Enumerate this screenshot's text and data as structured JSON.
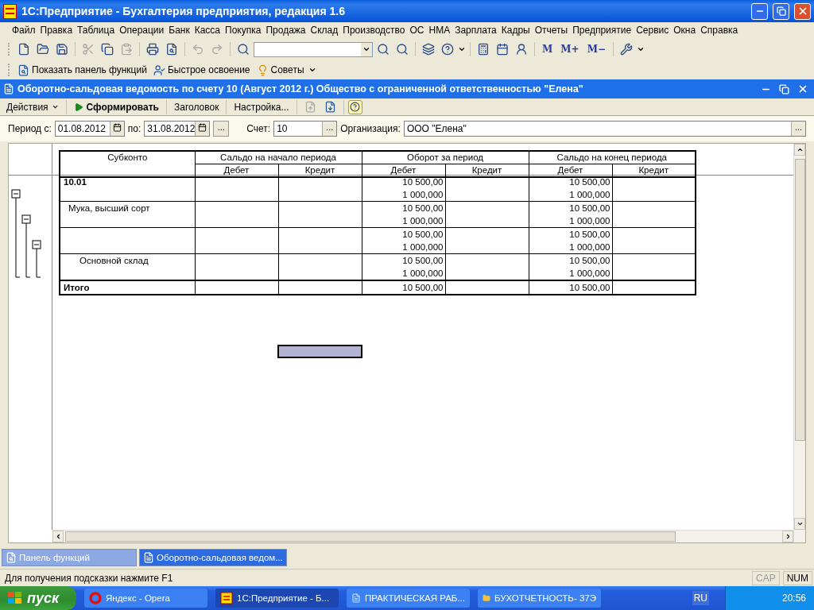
{
  "window": {
    "title": "1С:Предприятие - Бухгалтерия предприятия, редакция 1.6"
  },
  "menu": [
    "Файл",
    "Правка",
    "Таблица",
    "Операции",
    "Банк",
    "Касса",
    "Покупка",
    "Продажа",
    "Склад",
    "Производство",
    "ОС",
    "НМА",
    "Зарплата",
    "Кадры",
    "Отчеты",
    "Предприятие",
    "Сервис",
    "Окна",
    "Справка"
  ],
  "toolbar": [
    {
      "kind": "button",
      "disabled": false
    },
    {
      "kind": "button",
      "disabled": false
    },
    {
      "kind": "button",
      "disabled": false
    },
    {
      "kind": "separator"
    },
    {
      "kind": "button",
      "disabled": true
    },
    {
      "kind": "button",
      "disabled": false
    },
    {
      "kind": "button",
      "disabled": true
    },
    {
      "kind": "separator"
    },
    {
      "kind": "button",
      "disabled": false
    },
    {
      "kind": "button",
      "disabled": false
    },
    {
      "kind": "separator"
    },
    {
      "kind": "button",
      "disabled": true
    },
    {
      "kind": "button",
      "disabled": true
    },
    {
      "kind": "separator"
    },
    {
      "kind": "button",
      "disabled": false
    },
    {
      "kind": "search"
    },
    {
      "kind": "button",
      "disabled": false
    },
    {
      "kind": "button",
      "disabled": false
    },
    {
      "kind": "separator"
    },
    {
      "kind": "button",
      "disabled": false
    },
    {
      "kind": "menu_button",
      "disabled": false
    },
    {
      "kind": "separator"
    },
    {
      "kind": "button",
      "disabled": false
    },
    {
      "kind": "button",
      "disabled": false
    },
    {
      "kind": "button",
      "disabled": false
    },
    {
      "kind": "separator"
    },
    {
      "kind": "text",
      "label": "M"
    },
    {
      "kind": "text",
      "label": "M+"
    },
    {
      "kind": "text",
      "label": "M−"
    },
    {
      "kind": "separator"
    },
    {
      "kind": "menu_button",
      "disabled": false
    }
  ],
  "function_bar": [
    {
      "label": "Показать панель функций"
    },
    {
      "label": "Быстрое освоение"
    },
    {
      "label": "Советы"
    }
  ],
  "document": {
    "title": "Оборотно-сальдовая ведомость по счету 10 (Август 2012 г.) Общество с ограниченной ответственностью \"Елена\"",
    "actions": [
      {
        "kind": "menu",
        "label": "Действия"
      },
      {
        "kind": "run",
        "label": "Сформировать"
      },
      {
        "kind": "plain",
        "label": "Заголовок"
      },
      {
        "kind": "plain",
        "label": "Настройка..."
      },
      {
        "kind": "icon",
        "disabled": true
      },
      {
        "kind": "icon",
        "disabled": false
      },
      {
        "kind": "help"
      }
    ],
    "filters": {
      "period_from_label": "Период с:",
      "period_from": "01.08.2012",
      "period_to_label": "по:",
      "period_to": "31.08.2012",
      "period_button": "...",
      "account_label": "Счет:",
      "account": "10",
      "account_button": "...",
      "organization_label": "Организация:",
      "organization": "ООО \"Елена\"",
      "organization_button": "..."
    },
    "report": {
      "first_column": "Субконто",
      "column_groups": [
        {
          "label": "Сальдо на начало периода",
          "columns": [
            "Дебет",
            "Кредит"
          ]
        },
        {
          "label": "Оборот за период",
          "columns": [
            "Дебет",
            "Кредит"
          ]
        },
        {
          "label": "Сальдо на конец периода",
          "columns": [
            "Дебет",
            "Кредит"
          ]
        }
      ],
      "rows": [
        {
          "subconto": "10.01",
          "expanded": true,
          "turnover_debit": [
            "10 500,00",
            "1 000,000"
          ],
          "closing_debit": [
            "10 500,00",
            "1 000,000"
          ],
          "children": [
            {
              "subconto": "Мука, высший сорт",
              "expanded": true,
              "turnover_debit": [
                "10 500,00",
                "1 000,000"
              ],
              "closing_debit": [
                "10 500,00",
                "1 000,000"
              ],
              "children": [
                {
                  "expanded": true,
                  "turnover_debit": [
                    "10 500,00",
                    "1 000,000"
                  ],
                  "closing_debit": [
                    "10 500,00",
                    "1 000,000"
                  ],
                  "children": [
                    {
                      "subconto": "Основной склад",
                      "turnover_debit": [
                        "10 500,00",
                        "1 000,000"
                      ],
                      "closing_debit": [
                        "10 500,00",
                        "1 000,000"
                      ]
                    }
                  ]
                }
              ]
            }
          ]
        }
      ],
      "total": {
        "label": "Итого",
        "turnover_debit": "10 500,00",
        "closing_debit": "10 500,00"
      }
    }
  },
  "window_tabs": [
    {
      "label": "Панель функций",
      "selected": false
    },
    {
      "label": "Оборотно-сальдовая ведом...",
      "selected": true
    }
  ],
  "status_bar": {
    "hint": "Для получения подсказки нажмите F1",
    "indicators": [
      {
        "label": "CAP",
        "on": false
      },
      {
        "label": "NUM",
        "on": true
      }
    ]
  },
  "taskbar": {
    "start": "пуск",
    "tasks": [
      {
        "label": "Яндекс - Opera",
        "selected": false
      },
      {
        "label": "1С:Предприятие - Б...",
        "selected": true
      },
      {
        "label": "ПРАКТИЧЕСКАЯ РАБ...",
        "selected": false
      },
      {
        "label": "БУХОТЧЕТНОСТЬ- 37Э",
        "selected": false
      }
    ],
    "language": "RU",
    "clock": "20:56"
  }
}
